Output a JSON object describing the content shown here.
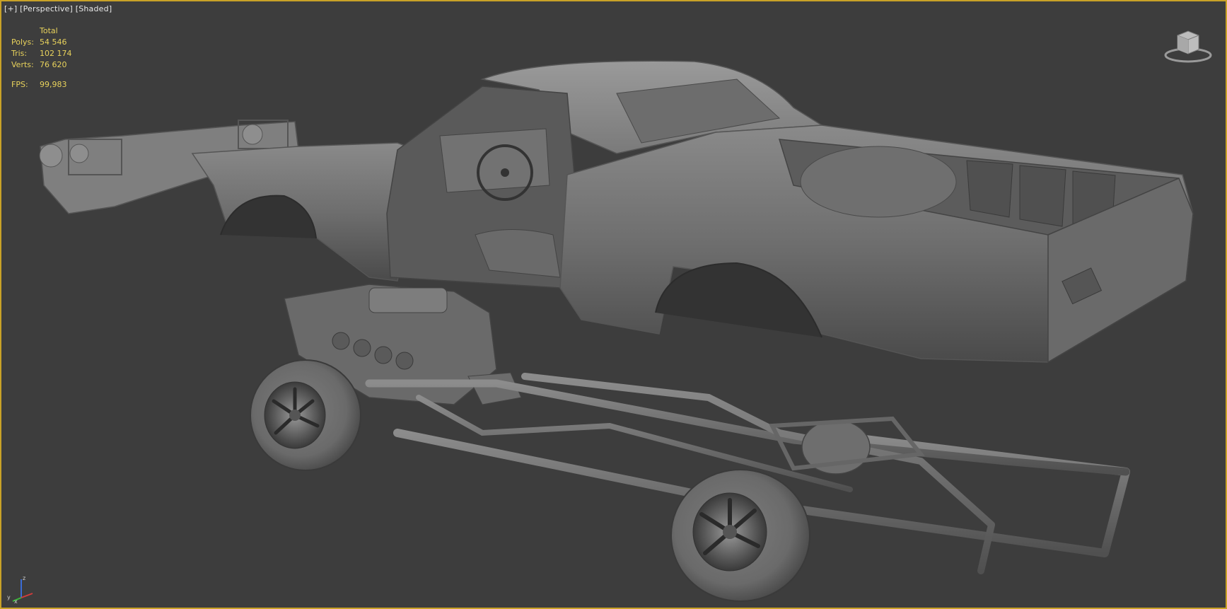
{
  "viewport": {
    "label_plus": "[+]",
    "label_view": "[Perspective]",
    "label_shading": "[Shaded]",
    "border_color": "#c9a227",
    "background_color": "#3d3d3d"
  },
  "stats": {
    "header": "Total",
    "rows": [
      {
        "key": "Polys:",
        "value": "54 546"
      },
      {
        "key": "Tris:",
        "value": "102 174"
      },
      {
        "key": "Verts:",
        "value": "76 620"
      }
    ],
    "fps_key": "FPS:",
    "fps_value": "99,983",
    "text_color": "#e8d25c"
  },
  "viewcube": {
    "icon": "viewcube-icon"
  },
  "axis_gizmo": {
    "icon": "axis-tripod-icon",
    "x_label": "x",
    "y_label": "y",
    "z_label": "z"
  }
}
